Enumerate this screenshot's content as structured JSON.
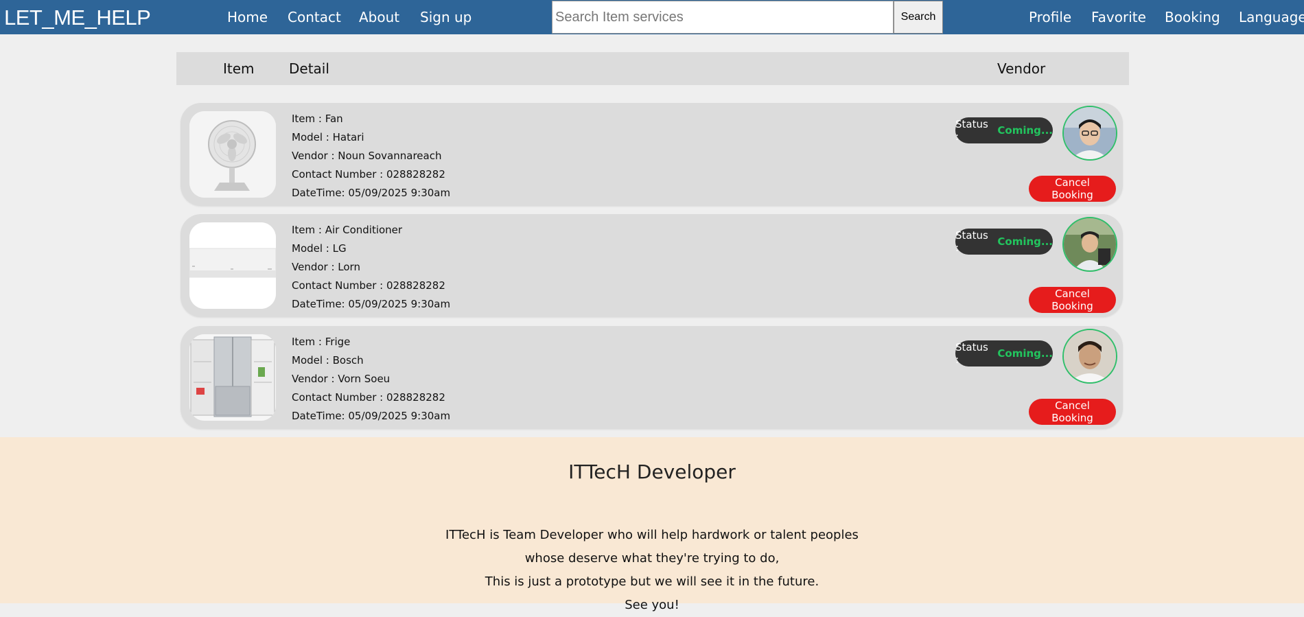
{
  "brand": "LET_ME_HELP",
  "nav_left": [
    "Home",
    "Contact",
    "About",
    "Sign up"
  ],
  "search": {
    "placeholder": "Search Item services",
    "button": "Search"
  },
  "nav_right": [
    "Profile",
    "Favorite",
    "Booking",
    "Language"
  ],
  "table_header": {
    "item": "Item",
    "detail": "Detail",
    "vendor": "Vendor"
  },
  "bookings": [
    {
      "item": "Item : Fan",
      "model": "Model : Hatari",
      "vendor": "Vendor : Noun Sovannareach",
      "contact": "Contact Number : 028828282",
      "datetime": "DateTime: 05/09/2025 9:30am",
      "status_label": "Status :",
      "status_value": "Coming...",
      "cancel": "Cancel Booking"
    },
    {
      "item": "Item : Air Conditioner",
      "model": "Model : LG",
      "vendor": "Vendor : Lorn",
      "contact": "Contact Number : 028828282",
      "datetime": "DateTime: 05/09/2025 9:30am",
      "status_label": "Status :",
      "status_value": "Coming...",
      "cancel": "Cancel Booking"
    },
    {
      "item": "Item : Frige",
      "model": "Model : Bosch",
      "vendor": "Vendor : Vorn Soeu",
      "contact": "Contact Number : 028828282",
      "datetime": "DateTime: 05/09/2025 9:30am",
      "status_label": "Status :",
      "status_value": "Coming...",
      "cancel": "Cancel Booking"
    }
  ],
  "footer": {
    "title": "ITTecH Developer",
    "lines": [
      "ITTecH is Team Developer who will help hardwork or talent peoples",
      "whose deserve what they're trying to do,",
      "This is just a prototype but we will see it in the future.",
      "See you!"
    ]
  },
  "colors": {
    "navbar": "#2e6598",
    "status_pill": "#333333",
    "status_value": "#22c55e",
    "cancel_button": "#e61c1c",
    "avatar_ring": "#2fbf6a",
    "footer_bg": "#f9e8d4"
  }
}
